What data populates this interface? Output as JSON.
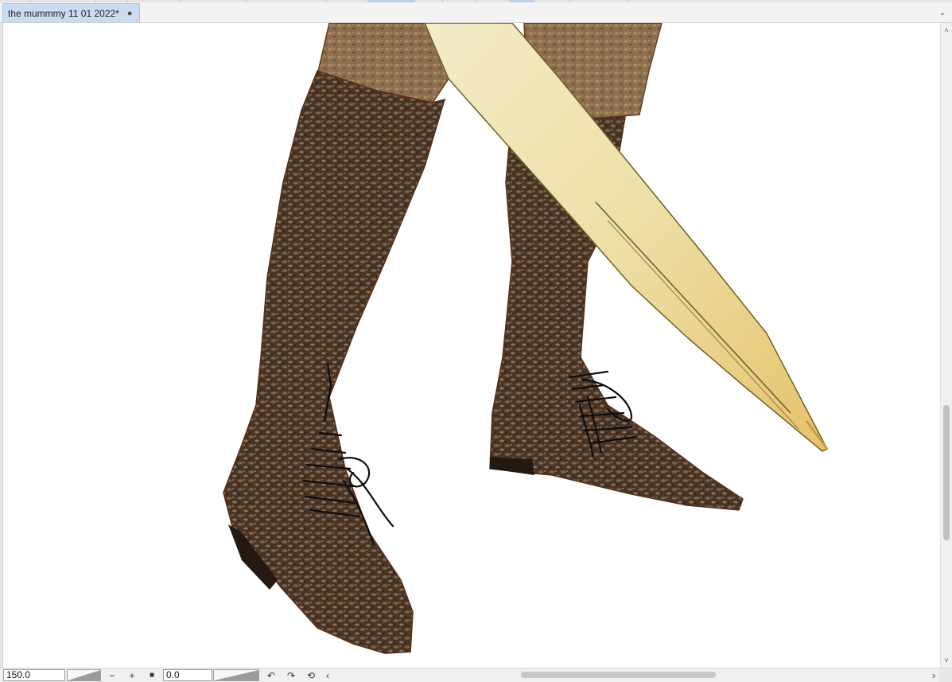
{
  "tab": {
    "title": "the mummmy 11 01 2022*",
    "modified_indicator": "●"
  },
  "statusbar": {
    "zoom_value": "150.0",
    "zoom_out_label": "−",
    "zoom_in_label": "+",
    "reset_label": "■",
    "rotation_value": "0.0",
    "rotate_left_label": "↶",
    "rotate_right_label": "↷",
    "reset_rotation_label": "⟲",
    "scroll_left_label": "‹",
    "scroll_right_label": "›"
  },
  "scrollbar": {
    "up_label": "˄",
    "down_label": "˅"
  },
  "tab_overflow_label": "⌄",
  "icons": [
    "chevron-down-icon",
    "zoom-out-icon",
    "zoom-in-icon",
    "stop-icon",
    "rotate-left-icon",
    "rotate-right-icon",
    "reset-rotation-icon",
    "chevron-left-icon",
    "chevron-right-icon"
  ]
}
